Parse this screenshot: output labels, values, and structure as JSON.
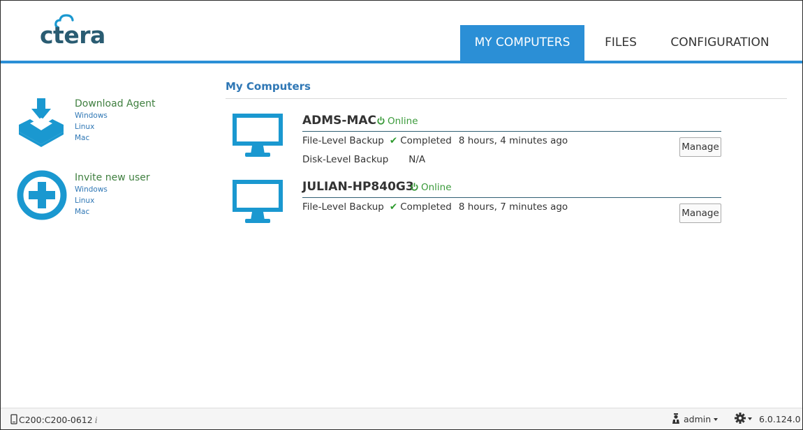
{
  "brand": {
    "logo_text": "ctera",
    "color": "#2a5c72",
    "accent": "#2b8fd6"
  },
  "nav": {
    "tabs": [
      {
        "label": "MY COMPUTERS",
        "active": true
      },
      {
        "label": "FILES",
        "active": false
      },
      {
        "label": "CONFIGURATION",
        "active": false
      }
    ]
  },
  "sidebar": {
    "download": {
      "title": "Download Agent",
      "icon": "download-tray-icon",
      "links": [
        "Windows",
        "Linux",
        "Mac"
      ]
    },
    "invite": {
      "title": "Invite new user",
      "icon": "plus-circle-icon",
      "links": [
        "Windows",
        "Linux",
        "Mac"
      ]
    }
  },
  "main": {
    "title": "My Computers",
    "computers": [
      {
        "name": "ADMS-MAC",
        "status": "Online",
        "rows": [
          {
            "label": "File-Level Backup",
            "value": "Completed",
            "time": "8 hours, 4 minutes ago",
            "check": true
          },
          {
            "label": "Disk-Level Backup",
            "value": "N/A",
            "time": "",
            "check": false
          }
        ],
        "action": "Manage"
      },
      {
        "name": "JULIAN-HP840G3",
        "status": "Online",
        "rows": [
          {
            "label": "File-Level Backup",
            "value": "Completed",
            "time": "8 hours, 7 minutes ago",
            "check": true
          }
        ],
        "action": "Manage"
      }
    ]
  },
  "footer": {
    "device": "C200:C200-0612",
    "info_glyph": "i",
    "user": "admin",
    "version": "6.0.124.0"
  },
  "colors": {
    "online": "#3a9a3a",
    "link": "#2f77b5",
    "side_title": "#3f7f3f",
    "monitor": "#1a98d0"
  }
}
